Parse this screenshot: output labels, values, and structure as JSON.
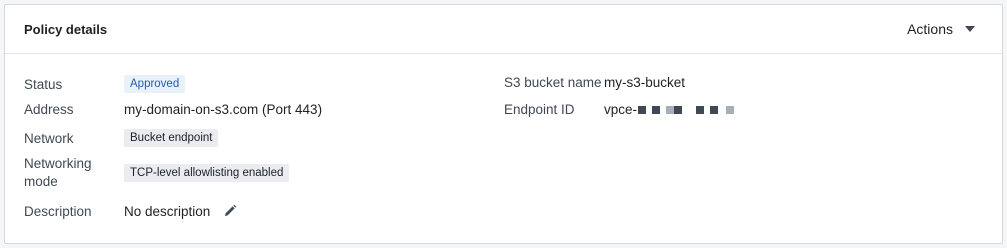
{
  "card": {
    "title": "Policy details",
    "actions_label": "Actions"
  },
  "left": {
    "status_label": "Status",
    "status_value": "Approved",
    "address_label": "Address",
    "address_value": "my-domain-on-s3.com (Port 443)",
    "network_label": "Network",
    "network_value": "Bucket endpoint",
    "networking_mode_label_line1": "Networking",
    "networking_mode_label_line2": "mode",
    "networking_mode_value": "TCP-level allowlisting enabled",
    "description_label": "Description",
    "description_value": "No description"
  },
  "right": {
    "bucket_label": "S3 bucket name",
    "bucket_value": "my-s3-bucket",
    "endpoint_label": "Endpoint ID",
    "endpoint_prefix": "vpce-"
  },
  "icons": {
    "actions_caret": "caret-down-icon",
    "description_edit": "pencil-icon"
  },
  "colors": {
    "approved_tag_bg": "#e9f1fb",
    "approved_tag_text": "#215db0",
    "neutral_tag_bg": "#eaecef"
  }
}
